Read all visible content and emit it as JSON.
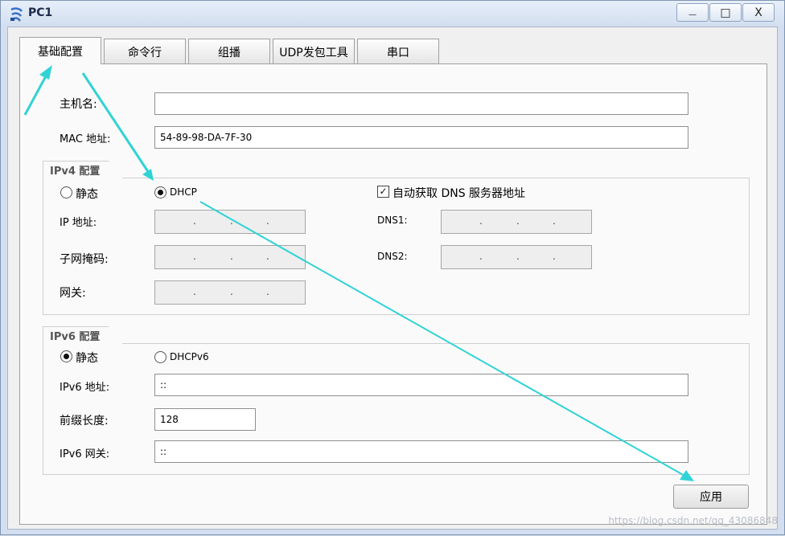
{
  "window": {
    "title": "PC1",
    "minimize_glyph": "—",
    "maximize_glyph": "□",
    "close_glyph": "X"
  },
  "tabs": [
    {
      "label": "基础配置",
      "active": true
    },
    {
      "label": "命令行",
      "active": false
    },
    {
      "label": "组播",
      "active": false
    },
    {
      "label": "UDP发包工具",
      "active": false
    },
    {
      "label": "串口",
      "active": false
    }
  ],
  "basic": {
    "hostname_label": "主机名:",
    "hostname_value": "",
    "mac_label": "MAC 地址:",
    "mac_value": "54-89-98-DA-7F-30"
  },
  "ipv4": {
    "group_title": "IPv4 配置",
    "static_label": "静态",
    "dhcp_label": "DHCP",
    "selected": "DHCP",
    "auto_dns_label": "自动获取 DNS 服务器地址",
    "auto_dns_checked": true,
    "ip_label": "IP 地址:",
    "mask_label": "子网掩码:",
    "gateway_label": "网关:",
    "dns1_label": "DNS1:",
    "dns2_label": "DNS2:",
    "ip_dot": "."
  },
  "ipv6": {
    "group_title": "IPv6 配置",
    "static_label": "静态",
    "dhcp_label": "DHCPv6",
    "selected": "静态",
    "address_label": "IPv6 地址:",
    "address_value": "::",
    "prefix_label": "前缀长度:",
    "prefix_value": "128",
    "gateway_label": "IPv6 网关:",
    "gateway_value": "::"
  },
  "apply_label": "应用",
  "watermark": "https://blog.csdn.net/qq_43086848",
  "colors": {
    "annotation_arrow": "#2fd3d6",
    "title_bar": "#d2def0",
    "panel": "#fafafa"
  }
}
